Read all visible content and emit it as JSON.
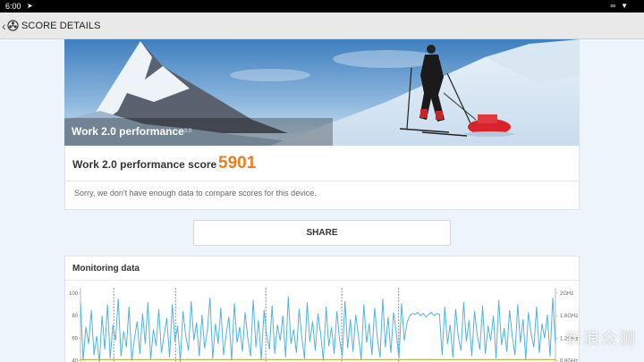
{
  "status_bar": {
    "time": "6:00",
    "left_icon": "location-arrow-icon",
    "right_icons": [
      "link-icon",
      "wifi-icon"
    ]
  },
  "app_bar": {
    "back_icon": "chevron-left-icon",
    "logo_icon": "futuremark-logo-icon",
    "title": "SCORE DETAILS"
  },
  "hero": {
    "title": "Work 2.0 performance",
    "version": "2.0"
  },
  "score": {
    "label": "Work 2.0 performance score",
    "value": "5901",
    "value_color": "#f07d1c",
    "note": "Sorry, we don't have enough data to compare scores for this device."
  },
  "share": {
    "label": "SHARE"
  },
  "monitoring": {
    "title": "Monitoring data"
  },
  "chart_data": {
    "type": "line",
    "left_axis_ticks": [
      "100",
      "80",
      "60",
      "40"
    ],
    "right_axis_ticks": [
      "2GHz",
      "1.6GHz",
      "1.2GHz",
      "0.8GHz"
    ],
    "ylim_left": [
      0,
      100
    ],
    "ylim_right": [
      0,
      2
    ],
    "series": [
      {
        "color": "#4fb4e4",
        "values": [
          92,
          40,
          70,
          55,
          85,
          45,
          62,
          38,
          80,
          50,
          90,
          42,
          72,
          58,
          95,
          44,
          66,
          52,
          88,
          40,
          60,
          75,
          46,
          82,
          55,
          92,
          41,
          68,
          53,
          86,
          47,
          63,
          78,
          43,
          90,
          57,
          71,
          39,
          84,
          62,
          49,
          93,
          58,
          74,
          44,
          81,
          51,
          67,
          96,
          42,
          73,
          55,
          87,
          45,
          64,
          79,
          40,
          91,
          56,
          70,
          48,
          83,
          60,
          44,
          94,
          52,
          76,
          41,
          85,
          63,
          50,
          89,
          46,
          72,
          58,
          80,
          43,
          97,
          55,
          68,
          47,
          86,
          61,
          42,
          92,
          57,
          75,
          49,
          82,
          64,
          40,
          88,
          53,
          70,
          46,
          84,
          59,
          44,
          93,
          51,
          77,
          48,
          81,
          62,
          41,
          90,
          56,
          73,
          45,
          87,
          60,
          43,
          95,
          52,
          79,
          47,
          83,
          65,
          42,
          91,
          58,
          74,
          80,
          82,
          81,
          83,
          80,
          82,
          79,
          81,
          83,
          80,
          82,
          81,
          45,
          88,
          55,
          72,
          43,
          86,
          61,
          49,
          92,
          57,
          76,
          44,
          84,
          63,
          50,
          89,
          46,
          71,
          58,
          80,
          42,
          94,
          54,
          69,
          48,
          85,
          62,
          45,
          90,
          56,
          77,
          41,
          83,
          64,
          52,
          88,
          47,
          73,
          60,
          81,
          44,
          96,
          55
        ]
      },
      {
        "color": "#c8a43a",
        "values": [
          0.82,
          0.82,
          0.82,
          0.82,
          0.82,
          0.82,
          0.82,
          0.82
        ]
      }
    ],
    "markers": [
      0.07,
      0.2,
      0.39,
      0.55,
      0.67
    ]
  }
}
